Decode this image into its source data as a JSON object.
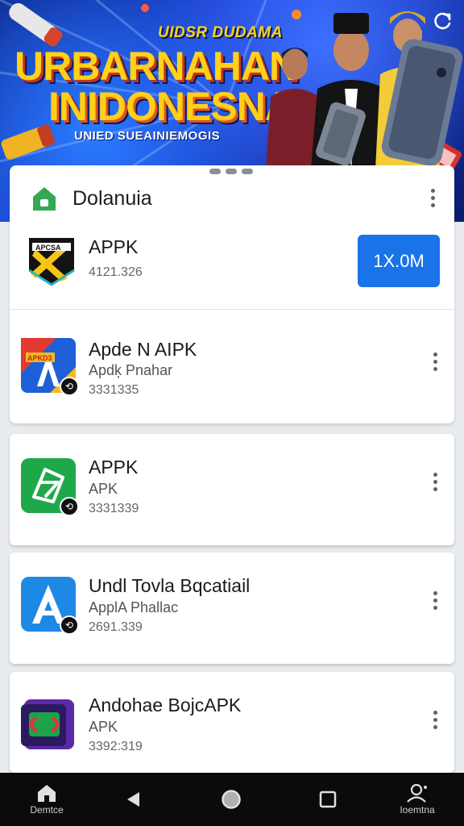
{
  "banner": {
    "subtitle": "UIDSR DUDAMA",
    "title_line1": "URBARNAHAN",
    "title_line2": "INIDONESNA",
    "tagline": "UNIED SUEAINIEMOGIS"
  },
  "sheet": {
    "title": "Dolanuia"
  },
  "apps": [
    {
      "name": "APPK",
      "subtitle": "",
      "meta": "4121.326",
      "button": "1X.0M",
      "icon": "apk-x-icon"
    },
    {
      "name": "Apde N AIPK",
      "subtitle": "Apdķ Pnahar",
      "meta": "3331335",
      "icon": "apk-blue-yellow-icon"
    },
    {
      "name": "APPK",
      "subtitle": "APK",
      "meta": "3331339",
      "icon": "apk-green-icon"
    },
    {
      "name": "Undl Tovla Bqcatiail",
      "subtitle": "ApplA Phallac",
      "meta": "2691.339",
      "icon": "apk-a-icon"
    },
    {
      "name": "Andohae BojcAPK",
      "subtitle": "APK",
      "meta": "3392:319",
      "icon": "apk-purple-icon"
    }
  ],
  "navbar": {
    "home_label": "Demtce",
    "profile_label": "Ioemtna"
  },
  "colors": {
    "accent": "#1a73e8",
    "banner_yellow": "#ffd21a",
    "banner_blue": "#1b3fd6",
    "nav_bg": "#0b0b0b"
  }
}
